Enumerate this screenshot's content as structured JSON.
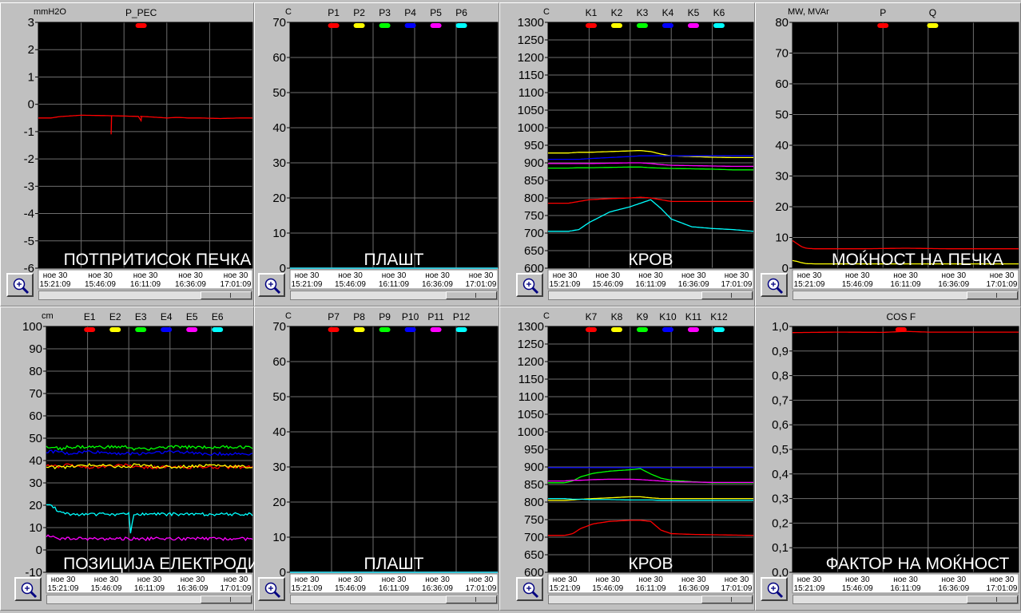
{
  "time_labels": [
    {
      "date": "ное 30",
      "time": "15:21:09"
    },
    {
      "date": "ное 30",
      "time": "15:46:09"
    },
    {
      "date": "ное 30",
      "time": "16:11:09"
    },
    {
      "date": "ное 30",
      "time": "16:36:09"
    },
    {
      "date": "ное 30",
      "time": "17:01:09"
    }
  ],
  "chart_data": [
    {
      "type": "line",
      "unit": "mmH2O",
      "title": "ПОТПРИТИСОК ПЕЧКА",
      "ylim": [
        -6,
        3
      ],
      "yticks": [
        "3",
        "2",
        "1",
        "0",
        "-1",
        "-2",
        "-3",
        "-4",
        "-5",
        "-6"
      ],
      "ytick_values": [
        3,
        2,
        1,
        0,
        -1,
        -2,
        -3,
        -4,
        -5,
        -6
      ],
      "x": [
        0,
        6,
        10,
        20,
        35,
        50,
        60,
        65,
        70,
        75,
        85,
        95,
        100
      ],
      "series": [
        {
          "name": "P_PEC",
          "color": "#ff0000",
          "values": [
            -0.5,
            -0.5,
            -0.45,
            -0.4,
            -0.42,
            -0.45,
            -0.5,
            -0.48,
            -0.5,
            -0.5,
            -0.52,
            -0.5,
            -0.5
          ],
          "spikes": [
            {
              "x": 34,
              "value": -1.1
            },
            {
              "x": 48,
              "value": -0.6
            }
          ]
        }
      ],
      "grid": true
    },
    {
      "type": "line",
      "unit": "C",
      "title": "ПЛАШТ",
      "ylim": [
        0,
        70
      ],
      "yticks": [
        "70",
        "60",
        "50",
        "40",
        "30",
        "20",
        "10",
        "0"
      ],
      "ytick_values": [
        70,
        60,
        50,
        40,
        30,
        20,
        10,
        0
      ],
      "x": [
        0,
        100
      ],
      "series": [
        {
          "name": "P1",
          "color": "#ff0000",
          "values": [
            0,
            0
          ]
        },
        {
          "name": "P2",
          "color": "#ffff00",
          "values": [
            0,
            0
          ]
        },
        {
          "name": "P3",
          "color": "#00ff00",
          "values": [
            0,
            0
          ]
        },
        {
          "name": "P4",
          "color": "#0000ff",
          "values": [
            0,
            0
          ]
        },
        {
          "name": "P5",
          "color": "#ff00ff",
          "values": [
            0,
            0
          ]
        },
        {
          "name": "P6",
          "color": "#00ffff",
          "values": [
            0,
            0
          ]
        }
      ],
      "grid": true
    },
    {
      "type": "line",
      "unit": "C",
      "title": "КРОВ",
      "ylim": [
        600,
        1300
      ],
      "yticks": [
        "1300",
        "1250",
        "1200",
        "1150",
        "1100",
        "1050",
        "1000",
        "950",
        "900",
        "850",
        "800",
        "750",
        "700",
        "650",
        "600"
      ],
      "ytick_values": [
        1300,
        1250,
        1200,
        1150,
        1100,
        1050,
        1000,
        950,
        900,
        850,
        800,
        750,
        700,
        650,
        600
      ],
      "x": [
        0,
        10,
        15,
        20,
        30,
        40,
        45,
        50,
        55,
        60,
        70,
        80,
        90,
        100
      ],
      "series": [
        {
          "name": "K1",
          "color": "#ff0000",
          "values": [
            785,
            785,
            790,
            795,
            798,
            800,
            802,
            800,
            795,
            790,
            790,
            790,
            790,
            790
          ]
        },
        {
          "name": "K2",
          "color": "#ffff00",
          "values": [
            928,
            928,
            930,
            930,
            932,
            934,
            935,
            932,
            925,
            920,
            918,
            916,
            915,
            915
          ]
        },
        {
          "name": "K3",
          "color": "#00ff00",
          "values": [
            885,
            885,
            886,
            886,
            887,
            888,
            888,
            886,
            885,
            884,
            883,
            882,
            880,
            880
          ]
        },
        {
          "name": "K4",
          "color": "#0000ff",
          "values": [
            910,
            910,
            910,
            912,
            915,
            918,
            920,
            920,
            920,
            920,
            920,
            920,
            920,
            920
          ]
        },
        {
          "name": "K5",
          "color": "#ff00ff",
          "values": [
            898,
            898,
            898,
            898,
            899,
            900,
            900,
            898,
            895,
            893,
            892,
            891,
            890,
            890
          ]
        },
        {
          "name": "K6",
          "color": "#00ffff",
          "values": [
            705,
            705,
            710,
            730,
            760,
            775,
            785,
            795,
            770,
            740,
            718,
            713,
            710,
            705
          ]
        }
      ],
      "grid": true
    },
    {
      "type": "line",
      "unit": "MW, MVAr",
      "title": "МОЌНОСТ НА ПЕЧКА",
      "ylim": [
        0,
        80
      ],
      "yticks": [
        "80",
        "70",
        "60",
        "50",
        "40",
        "30",
        "20",
        "10",
        "0"
      ],
      "ytick_values": [
        80,
        70,
        60,
        50,
        40,
        30,
        20,
        10,
        0
      ],
      "x": [
        0,
        2,
        4,
        6,
        10,
        30,
        50,
        70,
        100
      ],
      "series": [
        {
          "name": "P",
          "color": "#ff0000",
          "values": [
            9,
            8,
            7,
            6.5,
            6.3,
            6.3,
            6.5,
            6.3,
            6.3
          ]
        },
        {
          "name": "Q",
          "color": "#ffff00",
          "values": [
            2.5,
            2.2,
            1.8,
            1.5,
            1.4,
            1.4,
            1.4,
            1.4,
            1.4
          ]
        }
      ],
      "grid": true
    },
    {
      "type": "line",
      "unit": "cm",
      "title": "ПОЗИЦИЈА ЕЛЕКТРОДИ",
      "ylim": [
        -10,
        100
      ],
      "yticks": [
        "100",
        "90",
        "80",
        "70",
        "60",
        "50",
        "40",
        "30",
        "20",
        "10",
        "0",
        "-10"
      ],
      "ytick_values": [
        100,
        90,
        80,
        70,
        60,
        50,
        40,
        30,
        20,
        10,
        0,
        -10
      ],
      "x": [
        0,
        4,
        6,
        10,
        20,
        40,
        41,
        42,
        60,
        80,
        100
      ],
      "series": [
        {
          "name": "E1",
          "color": "#ff0000",
          "values": [
            38,
            38,
            37,
            38,
            37,
            38,
            38,
            37,
            37,
            37,
            37
          ]
        },
        {
          "name": "E2",
          "color": "#ffff00",
          "values": [
            37,
            37,
            38,
            37,
            38,
            37,
            37,
            38,
            37,
            38,
            37
          ]
        },
        {
          "name": "E3",
          "color": "#00ff00",
          "values": [
            46,
            46,
            45,
            46,
            46,
            46,
            46,
            45,
            46,
            46,
            46
          ]
        },
        {
          "name": "E4",
          "color": "#0000ff",
          "values": [
            44,
            44,
            44,
            43,
            44,
            43,
            43,
            43,
            44,
            43,
            43
          ]
        },
        {
          "name": "E5",
          "color": "#ff00ff",
          "values": [
            6,
            6,
            5,
            5,
            5,
            5,
            5,
            5,
            5,
            5,
            5
          ]
        },
        {
          "name": "E6",
          "color": "#00ffff",
          "values": [
            20,
            19,
            17,
            16,
            16,
            16,
            5,
            16,
            16,
            16,
            16
          ]
        }
      ],
      "grid": true
    },
    {
      "type": "line",
      "unit": "C",
      "title": "ПЛАШТ",
      "ylim": [
        0,
        70
      ],
      "yticks": [
        "70",
        "60",
        "50",
        "40",
        "30",
        "20",
        "10",
        "0"
      ],
      "ytick_values": [
        70,
        60,
        50,
        40,
        30,
        20,
        10,
        0
      ],
      "x": [
        0,
        100
      ],
      "series": [
        {
          "name": "P7",
          "color": "#ff0000",
          "values": [
            0,
            0
          ]
        },
        {
          "name": "P8",
          "color": "#ffff00",
          "values": [
            0,
            0
          ]
        },
        {
          "name": "P9",
          "color": "#00ff00",
          "values": [
            0,
            0
          ]
        },
        {
          "name": "P10",
          "color": "#0000ff",
          "values": [
            0,
            0
          ]
        },
        {
          "name": "P11",
          "color": "#ff00ff",
          "values": [
            0,
            0
          ]
        },
        {
          "name": "P12",
          "color": "#00ffff",
          "values": [
            0,
            0
          ]
        }
      ],
      "grid": true
    },
    {
      "type": "line",
      "unit": "C",
      "title": "КРОВ",
      "ylim": [
        600,
        1300
      ],
      "yticks": [
        "1300",
        "1250",
        "1200",
        "1150",
        "1100",
        "1050",
        "1000",
        "950",
        "900",
        "850",
        "800",
        "750",
        "700",
        "650",
        "600"
      ],
      "ytick_values": [
        1300,
        1250,
        1200,
        1150,
        1100,
        1050,
        1000,
        950,
        900,
        850,
        800,
        750,
        700,
        650,
        600
      ],
      "x": [
        0,
        8,
        12,
        16,
        22,
        30,
        40,
        45,
        50,
        55,
        60,
        70,
        80,
        100
      ],
      "series": [
        {
          "name": "K7",
          "color": "#ff0000",
          "values": [
            705,
            705,
            710,
            725,
            738,
            745,
            748,
            748,
            745,
            720,
            710,
            708,
            707,
            705
          ]
        },
        {
          "name": "K8",
          "color": "#ffff00",
          "values": [
            805,
            805,
            806,
            808,
            810,
            812,
            815,
            815,
            812,
            810,
            810,
            810,
            810,
            810
          ]
        },
        {
          "name": "K9",
          "color": "#00ff00",
          "values": [
            855,
            855,
            860,
            872,
            882,
            888,
            892,
            895,
            880,
            868,
            862,
            858,
            855,
            855
          ]
        },
        {
          "name": "K10",
          "color": "#0000ff",
          "values": [
            898,
            898,
            898,
            898,
            898,
            898,
            898,
            898,
            898,
            898,
            898,
            898,
            898,
            898
          ]
        },
        {
          "name": "K11",
          "color": "#ff00ff",
          "values": [
            860,
            860,
            862,
            862,
            864,
            865,
            865,
            864,
            862,
            860,
            858,
            857,
            856,
            856
          ]
        },
        {
          "name": "K12",
          "color": "#00ffff",
          "values": [
            810,
            810,
            808,
            808,
            807,
            807,
            806,
            806,
            806,
            805,
            805,
            805,
            805,
            805
          ]
        }
      ],
      "grid": true
    },
    {
      "type": "line",
      "unit": "",
      "title": "ФАКТОР НА МОЌНОСТ",
      "ylim": [
        0,
        1
      ],
      "yticks": [
        "1,0",
        "0,9",
        "0,8",
        "0,7",
        "0,6",
        "0,5",
        "0,4",
        "0,3",
        "0,2",
        "0,1",
        "0,0"
      ],
      "ytick_values": [
        1,
        0.9,
        0.8,
        0.7,
        0.6,
        0.5,
        0.4,
        0.3,
        0.2,
        0.1,
        0
      ],
      "x": [
        0,
        20,
        40,
        50,
        60,
        80,
        100
      ],
      "series": [
        {
          "name": "COS F",
          "color": "#ff0000",
          "values": [
            0.975,
            0.977,
            0.976,
            0.98,
            0.977,
            0.977,
            0.977
          ]
        }
      ],
      "grid": true
    }
  ]
}
